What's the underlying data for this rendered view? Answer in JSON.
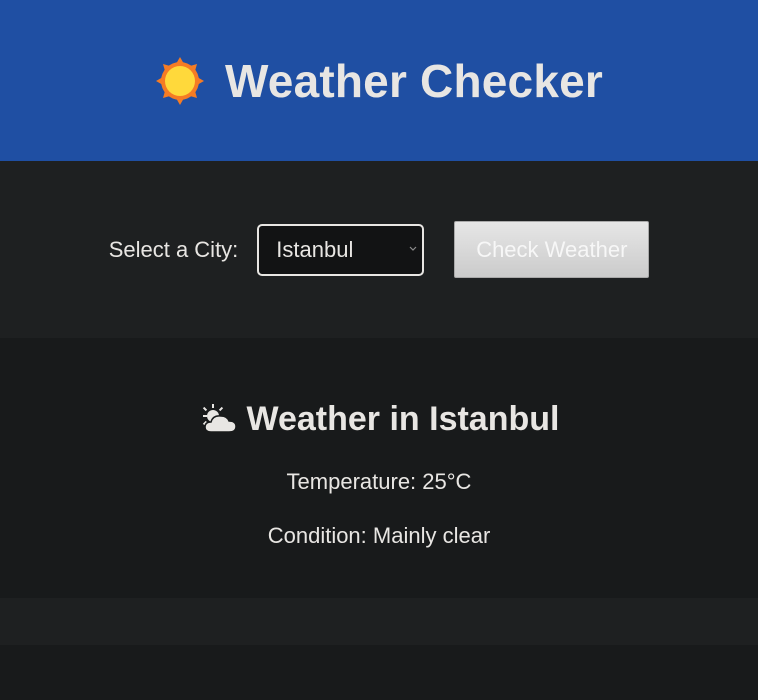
{
  "header": {
    "title": "Weather Checker",
    "icon": "sun-icon"
  },
  "form": {
    "label": "Select a City:",
    "selected_city": "Istanbul",
    "button_label": "Check Weather"
  },
  "result": {
    "title": "Weather in Istanbul",
    "icon": "sun-behind-cloud-icon",
    "temperature": "Temperature: 25°C",
    "condition": "Condition: Mainly clear"
  },
  "colors": {
    "header_bg": "#1f4fa3",
    "page_bg": "#181a1b",
    "section_bg": "#1e2021",
    "text": "#e8e6e3"
  }
}
